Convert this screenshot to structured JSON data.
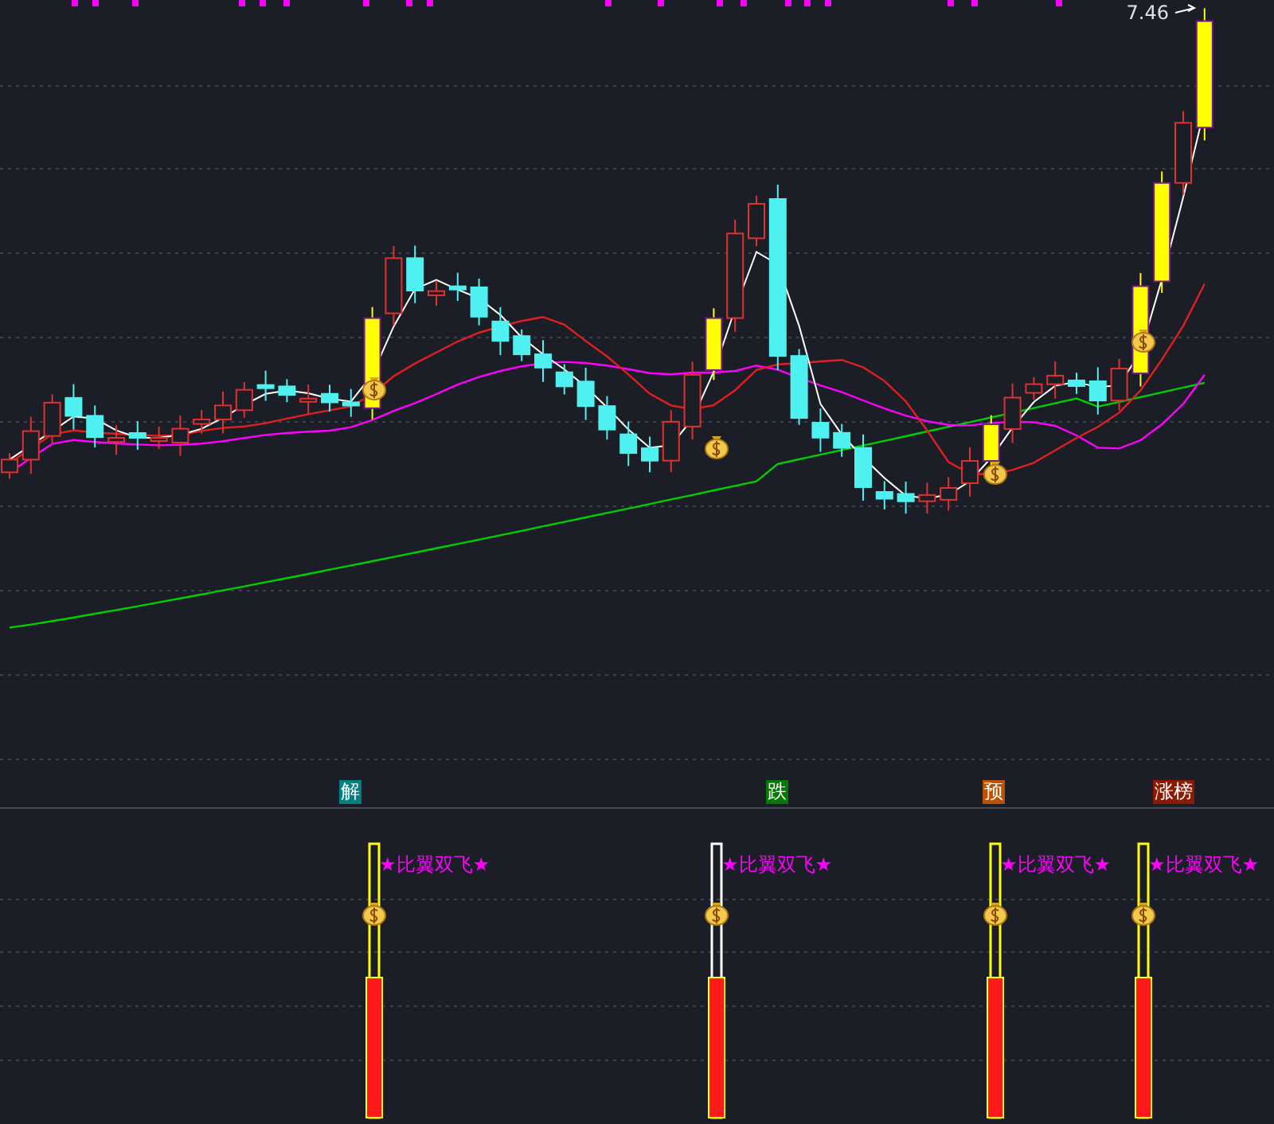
{
  "main_chart": {
    "price_label": "7.46"
  },
  "signals": [
    {
      "label": "解",
      "color": "#008080"
    },
    {
      "label": "跌",
      "color": "#007a00"
    },
    {
      "label": "预",
      "color": "#c05000"
    },
    {
      "label": "涨榜",
      "color": "#8b1a00"
    }
  ],
  "indicator": {
    "labels": [
      "★比翼双飞★",
      "★比翼双飞★",
      "★比翼双飞★",
      "★比翼双飞★"
    ]
  }
}
